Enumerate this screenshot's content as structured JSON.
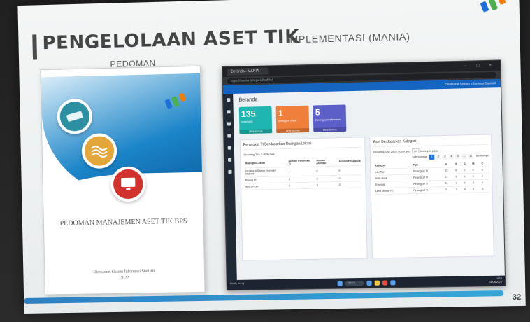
{
  "slide": {
    "title": "PENGELOLAAN ASET TIK",
    "left_heading": "PEDOMAN",
    "right_heading": "IMPLEMENTASI (MANIA)",
    "page_number": "32",
    "colors": {
      "accent": "#2f7fc1",
      "title": "#444444"
    }
  },
  "book": {
    "title": "PEDOMAN MANAJEMEN ASET TIK BPS",
    "publisher": "Direktorat Sistem Informasi Statistik",
    "year": "2022",
    "icons": [
      "scanner-icon",
      "network-icon",
      "monitor-icon"
    ]
  },
  "browser": {
    "tab_label": "Beranda - MANIA",
    "url": "https://mania.bps.go.id/public/",
    "user": "Direktorat Sistem Informasi Statistik",
    "window_controls": "– □ ×",
    "breadcrumb": "Beranda",
    "cards": [
      {
        "value": "135",
        "label": "perangkat",
        "more": "Lihat Semua",
        "color": "#1fb5b0"
      },
      {
        "value": "1",
        "label": "perangkat rusak",
        "more": "Lihat Semua",
        "color": "#f07f3c"
      },
      {
        "value": "5",
        "label": "barang, pemeliharaan",
        "more": "Lihat Semua",
        "color": "#5c5fc7"
      }
    ],
    "left_panel": {
      "title": "Perangkat TI Berdasarkan Ruangan/Lokasi",
      "info": "Showing 1 to 3 of 3 rows",
      "columns": [
        "Ruangan/Lokasi",
        "Jumlah Perangkat TI",
        "Jumlah Aktivasi",
        "Jumlah Pengguna"
      ],
      "rows": [
        [
          "Direktorat Sistem Informasi Statistik",
          "1",
          "0",
          "0"
        ],
        [
          "Ruang PIT",
          "0",
          "0",
          "0"
        ],
        [
          "Biro Umum",
          "0",
          "0",
          "0"
        ]
      ]
    },
    "right_panel": {
      "title": "Aset Berdasarkan Kategori",
      "info": "Showing 1 to 20 of 100 rows",
      "page_size": "20",
      "page_size_suffix": "rows per page",
      "pager_prev": "Sebelumnya",
      "pager_next": "Berikutnya",
      "pages": [
        "1",
        "2",
        "3",
        "4",
        "5",
        "…",
        "11"
      ],
      "active_page": "1",
      "columns": [
        "Kategori",
        "Tipe",
        "B",
        "S",
        "D",
        "M",
        "C"
      ],
      "rows": [
        [
          "Lap Top",
          "Perangkat TI",
          "26",
          "0",
          "0",
          "0",
          "0"
        ],
        [
          "Note Book",
          "Perangkat TI",
          "21",
          "0",
          "0",
          "0",
          "0"
        ],
        [
          "External",
          "Perangkat TI",
          "11",
          "0",
          "0",
          "0",
          "0"
        ],
        [
          "Ultra Mobile PC",
          "Perangkat TI",
          "0",
          "0",
          "0",
          "0",
          "0"
        ]
      ]
    },
    "taskbar": {
      "search": "Search",
      "weather": "Mostly Sunny",
      "time": "9:18",
      "date": "01/08/2024"
    }
  }
}
